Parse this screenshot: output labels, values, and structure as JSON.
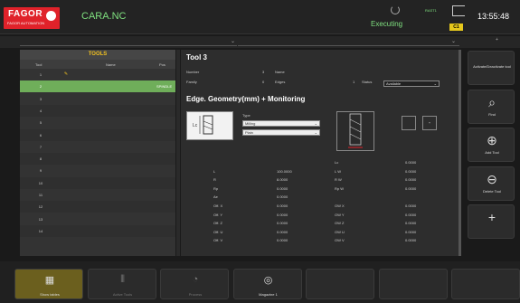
{
  "header": {
    "brand": "FAGOR",
    "brand_sub": "FAGOR AUTOMATION",
    "program": "CARA.NC",
    "exec_status": "Executing",
    "name_small": "RAST1",
    "channel": "C1",
    "clock": "13:55:48"
  },
  "topbar": {
    "plus": "+"
  },
  "tools_panel": {
    "title": "TOOLS",
    "col_tool": "Tool",
    "col_name": "Name",
    "col_pos": "Pos",
    "rows": [
      {
        "n": "1",
        "edit": "✎",
        "name": "",
        "pos": ""
      },
      {
        "n": "2",
        "edit": "",
        "name": "",
        "pos": "SPINDLE"
      },
      {
        "n": "3",
        "edit": "",
        "name": "",
        "pos": ""
      },
      {
        "n": "4",
        "edit": "",
        "name": "",
        "pos": ""
      },
      {
        "n": "5",
        "edit": "",
        "name": "",
        "pos": ""
      },
      {
        "n": "6",
        "edit": "",
        "name": "",
        "pos": ""
      },
      {
        "n": "7",
        "edit": "",
        "name": "",
        "pos": ""
      },
      {
        "n": "8",
        "edit": "",
        "name": "",
        "pos": ""
      },
      {
        "n": "9",
        "edit": "",
        "name": "",
        "pos": ""
      },
      {
        "n": "10",
        "edit": "",
        "name": "",
        "pos": ""
      },
      {
        "n": "11",
        "edit": "",
        "name": "",
        "pos": ""
      },
      {
        "n": "12",
        "edit": "",
        "name": "",
        "pos": ""
      },
      {
        "n": "13",
        "edit": "",
        "name": "",
        "pos": ""
      },
      {
        "n": "14",
        "edit": "",
        "name": "",
        "pos": ""
      }
    ]
  },
  "detail": {
    "title": "Tool 3",
    "number_label": "Number",
    "number_val": "3",
    "name_label": "Name",
    "family_label": "Family",
    "family_val": "0",
    "edges_label": "Edges",
    "edges_val": "1",
    "status_label": "Status",
    "status_val": "Available",
    "section": "Edge. Geometry(mm) + Monitoring",
    "type_label": "Type",
    "type_val1": "Milling",
    "type_val2": "Plain",
    "lc_val": "Lc",
    "minus": "-",
    "geo": [
      {
        "k": "",
        "v": "",
        "k2": "Lc",
        "v2": "0.0000"
      },
      {
        "k": "L",
        "v": "100.0000",
        "k2": "L W",
        "v2": "0.0000"
      },
      {
        "k": "R",
        "v": "8.0000",
        "k2": "R W",
        "v2": "0.0000"
      },
      {
        "k": "Rp",
        "v": "0.0000",
        "k2": "Rp W",
        "v2": "0.0000"
      },
      {
        "k": "Ae",
        "v": "0.0000",
        "k2": "",
        "v2": ""
      },
      {
        "k": "Off. X",
        "v": "0.0000",
        "k2": "OW X",
        "v2": "0.0000"
      },
      {
        "k": "Off. Y",
        "v": "0.0000",
        "k2": "OW Y",
        "v2": "0.0000"
      },
      {
        "k": "Off. Z",
        "v": "0.0000",
        "k2": "OW Z",
        "v2": "0.0000"
      },
      {
        "k": "Off. U",
        "v": "0.0000",
        "k2": "OW U",
        "v2": "0.0000"
      },
      {
        "k": "Off. V",
        "v": "0.0000",
        "k2": "OW V",
        "v2": "0.0000"
      }
    ]
  },
  "side": [
    {
      "label": "Activate/Deactivate tool",
      "icon": ""
    },
    {
      "label": "Find",
      "icon": "⌕"
    },
    {
      "label": "Add Tool",
      "icon": "⊕"
    },
    {
      "label": "Delete Tool",
      "icon": "⊖"
    },
    {
      "label": "",
      "icon": "+"
    }
  ],
  "bottom": [
    {
      "label": "Show tables",
      "icon": "▦",
      "active": true
    },
    {
      "label": "Active Tools",
      "icon": "⫴",
      "active": false
    },
    {
      "label": "Process",
      "icon": "◔",
      "active": false
    },
    {
      "label": "Magazine 1",
      "icon": "◎",
      "active": false
    },
    {
      "label": "",
      "icon": "",
      "active": false
    },
    {
      "label": "",
      "icon": "",
      "active": false
    },
    {
      "label": "",
      "icon": "",
      "active": false
    }
  ]
}
